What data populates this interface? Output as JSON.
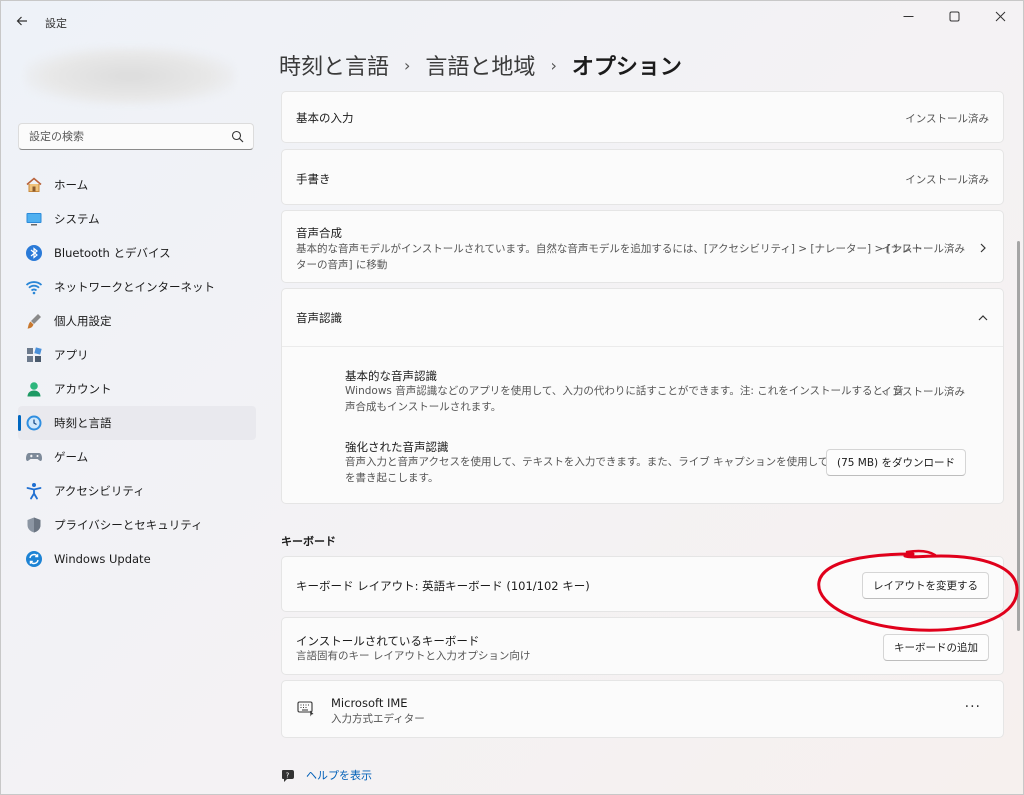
{
  "app": {
    "title": "設定",
    "colors": {
      "accent": "#0067c0",
      "annotation": "#e0001b"
    }
  },
  "window_controls": [
    "minimize-icon",
    "maximize-icon",
    "close-icon"
  ],
  "search": {
    "placeholder": "設定の検索"
  },
  "nav": {
    "items": [
      {
        "label": "ホーム",
        "icon": "home-icon"
      },
      {
        "label": "システム",
        "icon": "system-icon"
      },
      {
        "label": "Bluetooth とデバイス",
        "icon": "bluetooth-icon"
      },
      {
        "label": "ネットワークとインターネット",
        "icon": "wifi-icon"
      },
      {
        "label": "個人用設定",
        "icon": "brush-icon"
      },
      {
        "label": "アプリ",
        "icon": "apps-icon"
      },
      {
        "label": "アカウント",
        "icon": "account-icon"
      },
      {
        "label": "時刻と言語",
        "icon": "time-language-icon",
        "active": true
      },
      {
        "label": "ゲーム",
        "icon": "gamepad-icon"
      },
      {
        "label": "アクセシビリティ",
        "icon": "accessibility-icon"
      },
      {
        "label": "プライバシーとセキュリティ",
        "icon": "shield-icon"
      },
      {
        "label": "Windows Update",
        "icon": "update-icon"
      }
    ]
  },
  "breadcrumb": {
    "items": [
      "時刻と言語",
      "言語と地域",
      "オプション"
    ]
  },
  "language_features": {
    "basic_input": {
      "title": "基本の入力",
      "status": "インストール済み"
    },
    "handwriting": {
      "title": "手書き",
      "status": "インストール済み"
    },
    "tts": {
      "title": "音声合成",
      "desc_line1": "基本的な音声モデルがインストールされています。自然な音声モデルを追加するには、[アクセシビリティ] > [ナレーター] > [ナレー",
      "desc_line2": "ターの音声] に移動",
      "status": "インストール済み"
    },
    "speech_recognition": {
      "title": "音声認識",
      "basic": {
        "title": "基本的な音声認識",
        "desc_line1": "Windows 音声認識などのアプリを使用して、入力の代わりに話すことができます。注: これをインストールすると、音",
        "desc_line2": "声合成もインストールされます。",
        "status": "インストール済み"
      },
      "enhanced": {
        "title": "強化された音声認識",
        "desc_line1": "音声入力と音声アクセスを使用して、テキストを入力できます。また、ライブ キャプションを使用して、音声",
        "desc_line2": "を書き起こします。",
        "button": "(75 MB) をダウンロード"
      }
    }
  },
  "keyboard": {
    "section_label": "キーボード",
    "layout": {
      "title": "キーボード レイアウト: 英語キーボード (101/102 キー)",
      "button": "レイアウトを変更する"
    },
    "installed": {
      "title": "インストールされているキーボード",
      "desc": "言語固有のキー レイアウトと入力オプション向け",
      "button": "キーボードの追加"
    },
    "ime": {
      "title": "Microsoft IME",
      "desc": "入力方式エディター",
      "more": "···"
    }
  },
  "help": {
    "label": "ヘルプを表示"
  }
}
